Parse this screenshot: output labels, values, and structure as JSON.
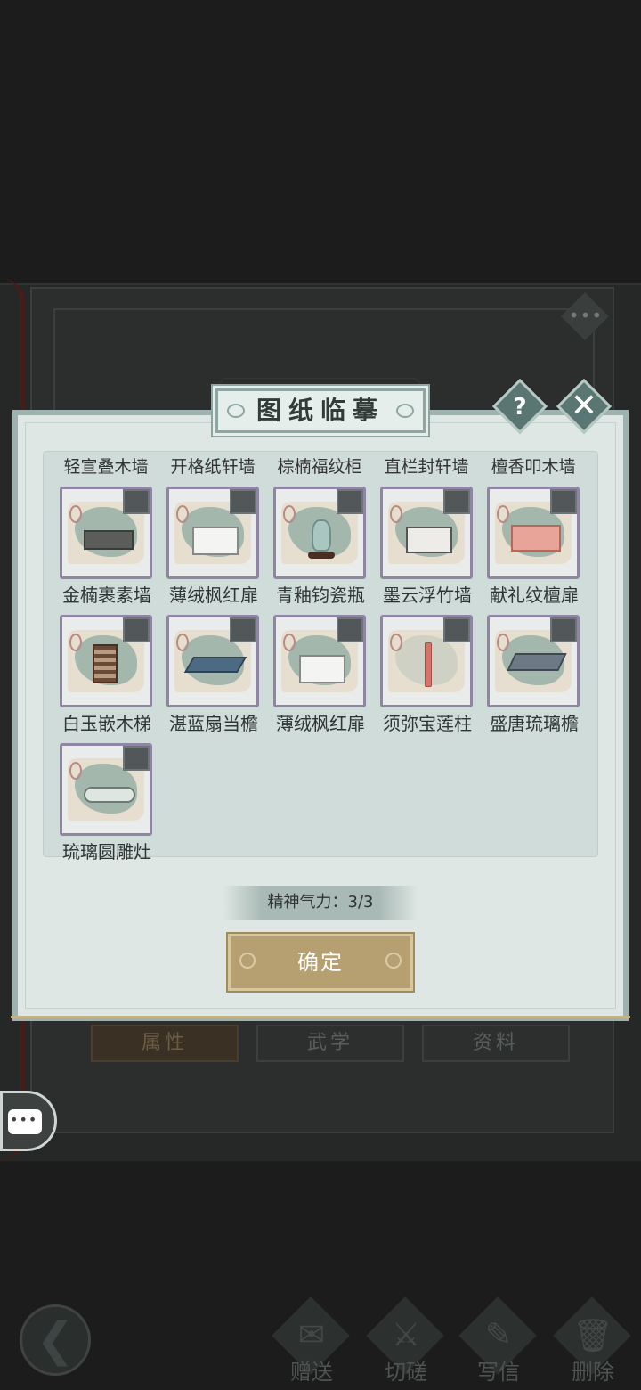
{
  "dialog": {
    "title": "图纸临摹",
    "help_icon": "?",
    "close_icon": "✕"
  },
  "under": {
    "tabs": [
      "属性",
      "武学",
      "资料"
    ]
  },
  "cut_row": [
    "轻宣叠木墙",
    "开格纸轩墙",
    "棕楠福纹柜",
    "直栏封轩墙",
    "檀香叩木墙"
  ],
  "items": [
    {
      "name": "金楠裹素墙",
      "icon": "wall-icon"
    },
    {
      "name": "薄绒枫红扉",
      "icon": "screen-icon"
    },
    {
      "name": "青釉钧瓷瓶",
      "icon": "vase-icon"
    },
    {
      "name": "墨云浮竹墙",
      "icon": "wall-icon"
    },
    {
      "name": "献礼纹檀扉",
      "icon": "screen-icon"
    },
    {
      "name": "白玉嵌木梯",
      "icon": "ladder-icon"
    },
    {
      "name": "湛蓝扇当檐",
      "icon": "eave-icon"
    },
    {
      "name": "薄绒枫红扉",
      "icon": "screen-icon"
    },
    {
      "name": "须弥宝莲柱",
      "icon": "pillar-icon"
    },
    {
      "name": "盛唐琉璃檐",
      "icon": "eave-icon"
    },
    {
      "name": "琉璃圆雕灶",
      "icon": "stove-icon"
    }
  ],
  "energy": {
    "label": "精神气力：3/3"
  },
  "confirm": {
    "label": "确定"
  },
  "bottom_actions": [
    {
      "label": "赠送",
      "icon": "gift-icon"
    },
    {
      "label": "切磋",
      "icon": "sword-icon"
    },
    {
      "label": "写信",
      "icon": "letter-icon"
    },
    {
      "label": "删除",
      "icon": "trash-icon"
    }
  ],
  "colors": {
    "panel": "#dfe7e4",
    "frame": "#9eb2af",
    "card_border": "#8e86a3",
    "confirm": "#b6a071",
    "background": "#1c1c1c"
  }
}
